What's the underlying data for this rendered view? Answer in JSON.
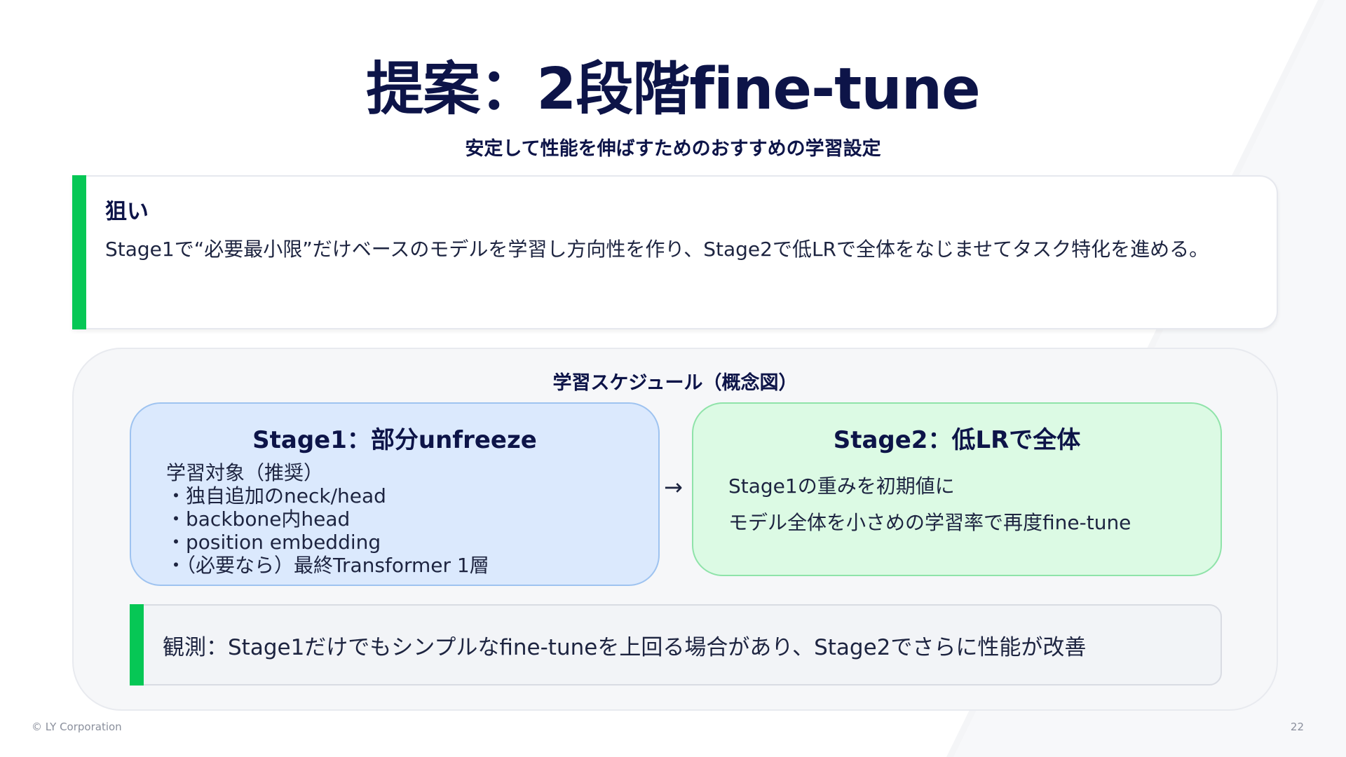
{
  "title": "提案：2段階fine-tune",
  "subtitle": "安定して性能を伸ばすためのおすすめの学習設定",
  "aim": {
    "heading": "狙い",
    "text": "Stage1で“必要最小限”だけベースのモデルを学習し方向性を作り、Stage2で低LRで全体をなじませてタスク特化を進める。"
  },
  "schedule": {
    "title": "学習スケジュール（概念図）",
    "stage1": {
      "title": "Stage1：部分unfreeze",
      "lines": [
        "学習対象（推奨）",
        "・独自追加のneck/head",
        "・backbone内head",
        "・position embedding",
        "・（必要なら）最終Transformer 1層"
      ]
    },
    "arrow": "→",
    "stage2": {
      "title": "Stage2：低LRで全体",
      "lines": [
        "Stage1の重みを初期値に",
        "モデル全体を小さめの学習率で再度fine-tune"
      ]
    },
    "observation": "観測：Stage1だけでもシンプルなfine-tuneを上回る場合があり、Stage2でさらに性能が改善"
  },
  "footer": {
    "copyright": "© LY Corporation",
    "page_number": "22"
  },
  "colors": {
    "accent": "#06c755",
    "title": "#0d1448",
    "stage1_bg": "#dbe9fd",
    "stage2_bg": "#dcfae4"
  }
}
